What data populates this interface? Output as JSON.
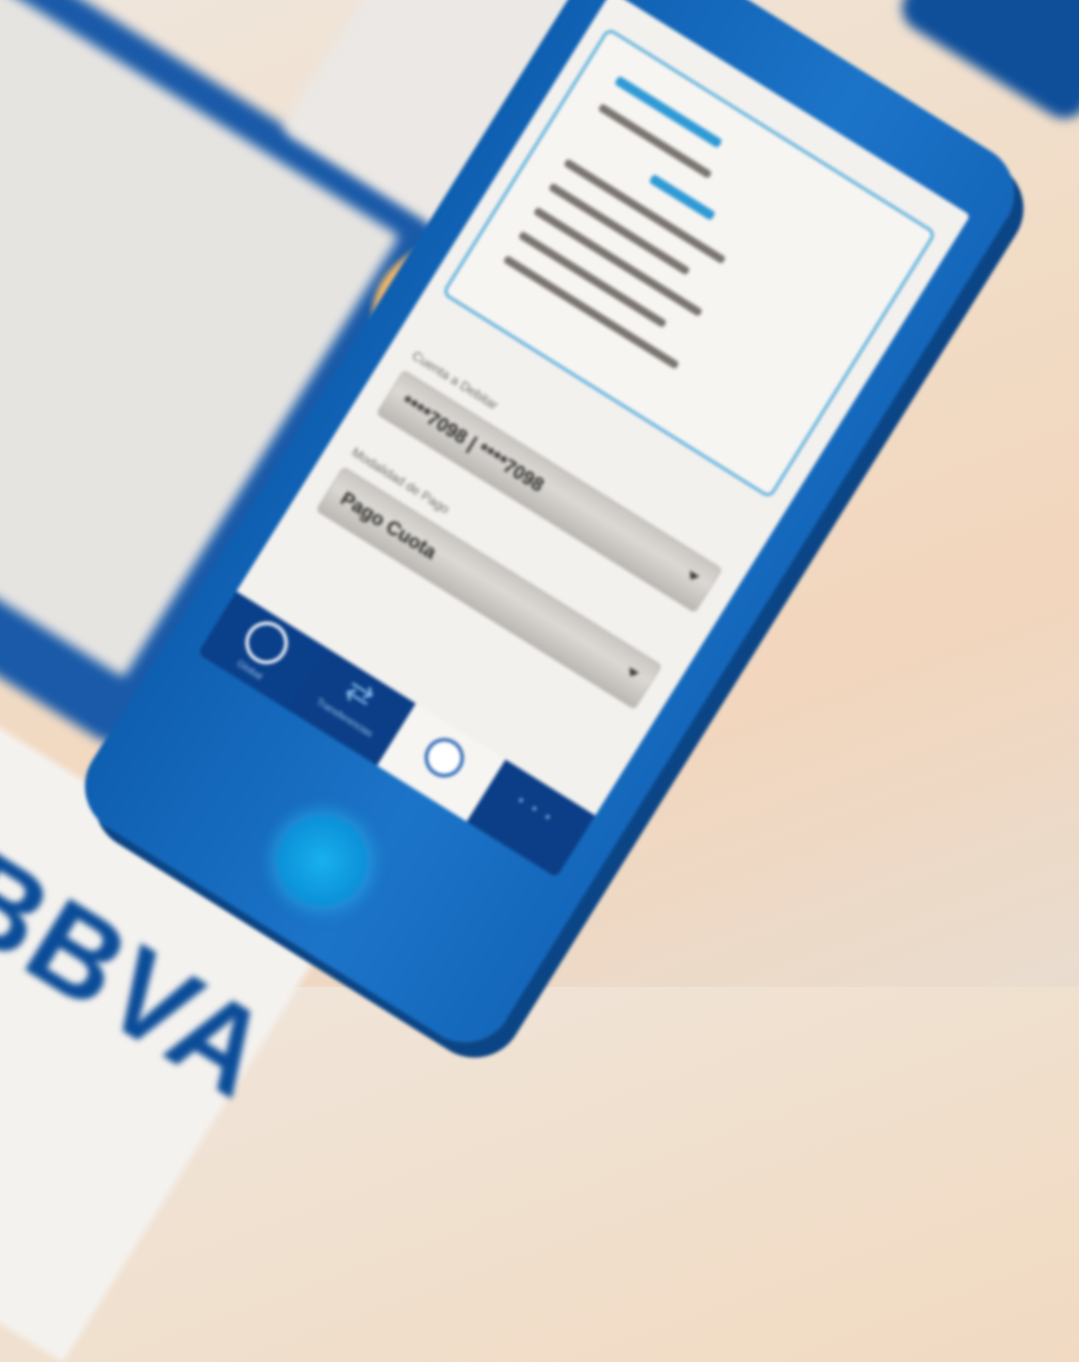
{
  "brand": {
    "logo_text": "BBVA"
  },
  "payment_form": {
    "account_label": "Cuenta a Debitar",
    "account_value": "****7098 | ****7098",
    "mode_label": "Modalidad de Pago",
    "mode_value": "Pago Cuota"
  },
  "tabs": [
    {
      "label": "Global",
      "icon": "globe-icon",
      "active": true
    },
    {
      "label": "Transferencias",
      "icon": "transfer-icon",
      "active": false
    },
    {
      "label": "",
      "icon": "lock-icon",
      "active": false
    },
    {
      "label": "",
      "icon": "more-icon",
      "active": false
    }
  ],
  "colors": {
    "brand_blue": "#0b4c98",
    "phone_blue": "#1c74c8",
    "accent_orange": "#f0b66a",
    "home_button": "#19b0ee"
  }
}
